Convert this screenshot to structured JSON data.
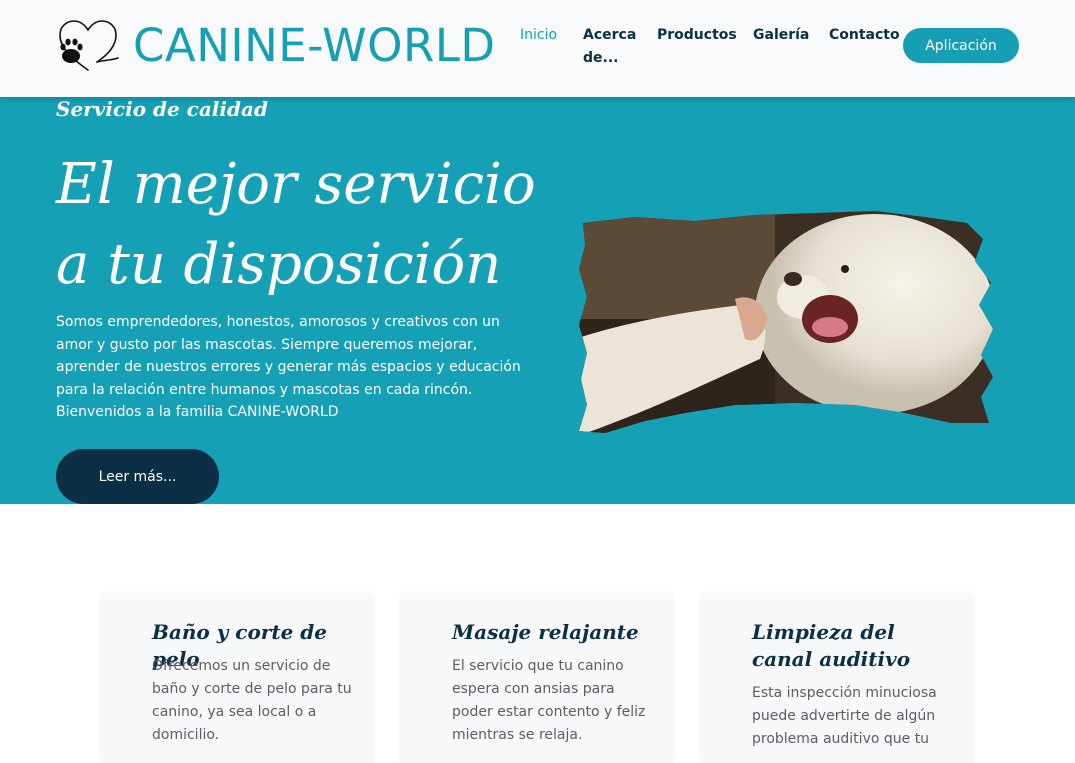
{
  "header": {
    "logo_text": "CANINE-WORLD",
    "nav": [
      {
        "label": "Inicio",
        "active": true
      },
      {
        "label": "Acerca de...",
        "active": false
      },
      {
        "label": "Productos",
        "active": false
      },
      {
        "label": "Galería",
        "active": false
      },
      {
        "label": "Contacto",
        "active": false
      }
    ],
    "nav_acerca_line1": "Acerca",
    "nav_acerca_line2": "de...",
    "cta_label": "Aplicación"
  },
  "hero": {
    "eyebrow": "Servicio de calidad",
    "title_line1": "El mejor servicio",
    "title_line2": "a tu disposición",
    "text": "Somos emprendedores, honestos, amorosos y creativos con un amor y gusto por las mascotas. Siempre queremos mejorar, aprender de nuestros errores y generar más espacios y educación para la relación entre humanos y mascotas en cada rincón. Bienvenidos a la familia CANINE-WORLD",
    "button_label": "Leer más..."
  },
  "services": [
    {
      "title": "Baño y corte de pelo",
      "text": "Ofrecemos un servicio de baño y corte de pelo para tu canino, ya sea local o a domicilio."
    },
    {
      "title": "Masaje relajante",
      "text": "El servicio que tu canino espera con ansias para poder estar contento y feliz mientras se relaja."
    },
    {
      "title": "Limpieza del canal auditivo",
      "text": "Esta inspección minuciosa puede advertirte de algún problema auditivo que tu"
    }
  ],
  "colors": {
    "brand": "#169fb4",
    "dark": "#0b2f44",
    "header_bg": "#f8f9fa"
  },
  "icons": {
    "logo": "paw-heart-icon"
  }
}
